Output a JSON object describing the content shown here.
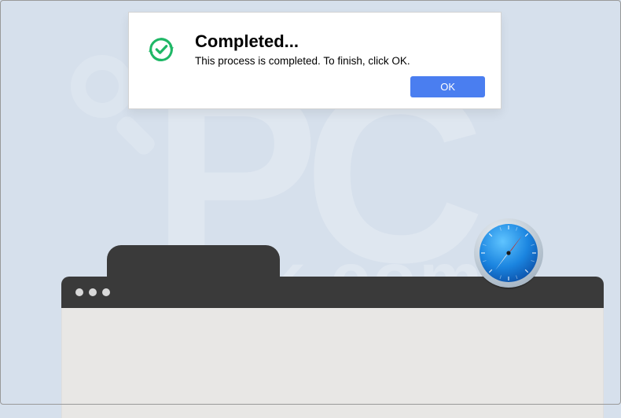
{
  "dialog": {
    "title": "Completed...",
    "message": "This process is completed. To finish, click OK.",
    "ok_label": "OK"
  },
  "watermark": {
    "big": "PC",
    "sub": "risk.com"
  },
  "icons": {
    "checkmark": "checkmark-refresh-icon",
    "safari": "safari-icon"
  },
  "colors": {
    "accent_button": "#4a7ef0",
    "checkmark_green": "#1fb766",
    "background": "#d6e0ec",
    "browser_chrome": "#3a3a3a",
    "browser_body": "#e8e7e5"
  }
}
